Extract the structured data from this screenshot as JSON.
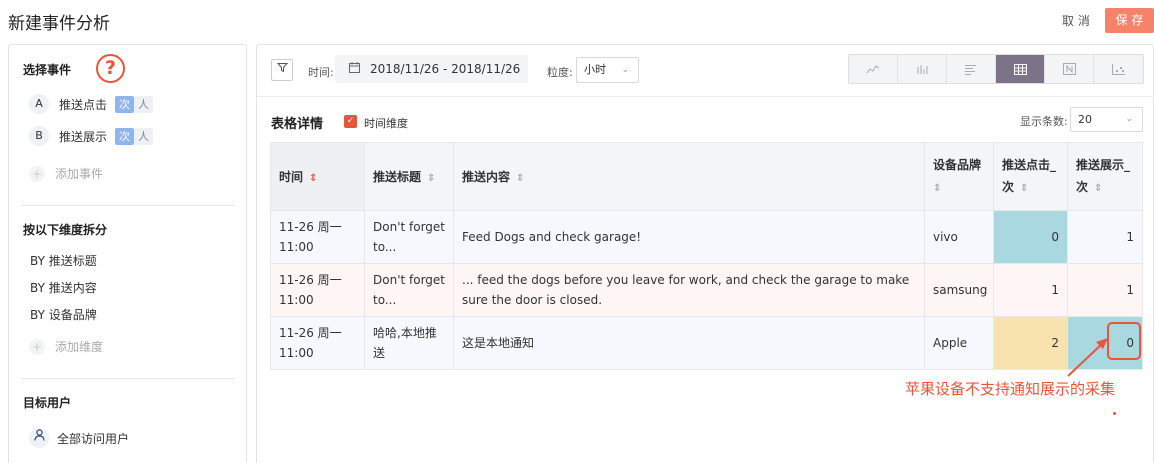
{
  "header": {
    "title": "新建事件分析",
    "cancel_label": "取 消",
    "save_label": "保 存"
  },
  "left": {
    "events_title": "选择事件",
    "help_glyph": "?",
    "events": [
      {
        "letter": "A",
        "name": "推送点击",
        "chip_ci": "次",
        "chip_ren": "人"
      },
      {
        "letter": "B",
        "name": "推送展示",
        "chip_ci": "次",
        "chip_ren": "人"
      }
    ],
    "add_event": "添加事件",
    "dimensions_title": "按以下维度拆分",
    "dimensions": [
      "BY 推送标题",
      "BY 推送内容",
      "BY 设备品牌"
    ],
    "add_dimension": "添加维度",
    "target_title": "目标用户",
    "target_user": "全部访问用户"
  },
  "toolbar": {
    "time_label": "时间:",
    "date_range": "2018/11/26 - 2018/11/26",
    "granularity_label": "粒度:",
    "granularity_value": "小时",
    "chart_types": [
      "line-chart-icon",
      "bar-chart-icon",
      "horizontal-bar-icon",
      "table-icon",
      "number-icon",
      "scatter-icon"
    ],
    "active_chart": "table-icon"
  },
  "table_section": {
    "title": "表格详情",
    "time_dimension_label": "时间维度",
    "rows_label": "显示条数:",
    "rows_value": "20"
  },
  "table": {
    "headers": [
      "时间",
      "推送标题",
      "推送内容",
      "设备品牌",
      "推送点击_次",
      "推送展示_次"
    ],
    "rows": [
      {
        "time": "11-26 周一 11:00",
        "title": "Don't forget to...",
        "content": "Feed Dogs and check garage!",
        "brand": "vivo",
        "clicks": "0",
        "shows": "1"
      },
      {
        "time": "11-26 周一 11:00",
        "title": "Don't forget to...",
        "content": "... feed the dogs before you leave for work, and check the garage to make sure the door is closed.",
        "brand": "samsung",
        "clicks": "1",
        "shows": "1"
      },
      {
        "time": "11-26 周一 11:00",
        "title": "哈哈,本地推送",
        "content": "这是本地通知",
        "brand": "Apple",
        "clicks": "2",
        "shows": "0"
      }
    ]
  },
  "annotation": {
    "text": "苹果设备不支持通知展示的采集",
    "color": "#e8553b"
  },
  "colors": {
    "accent": "#f58369",
    "highlight_blue": "#a9d8e0",
    "highlight_yellow": "#f8e3ae",
    "chip_blue": "#8fb4f0"
  }
}
